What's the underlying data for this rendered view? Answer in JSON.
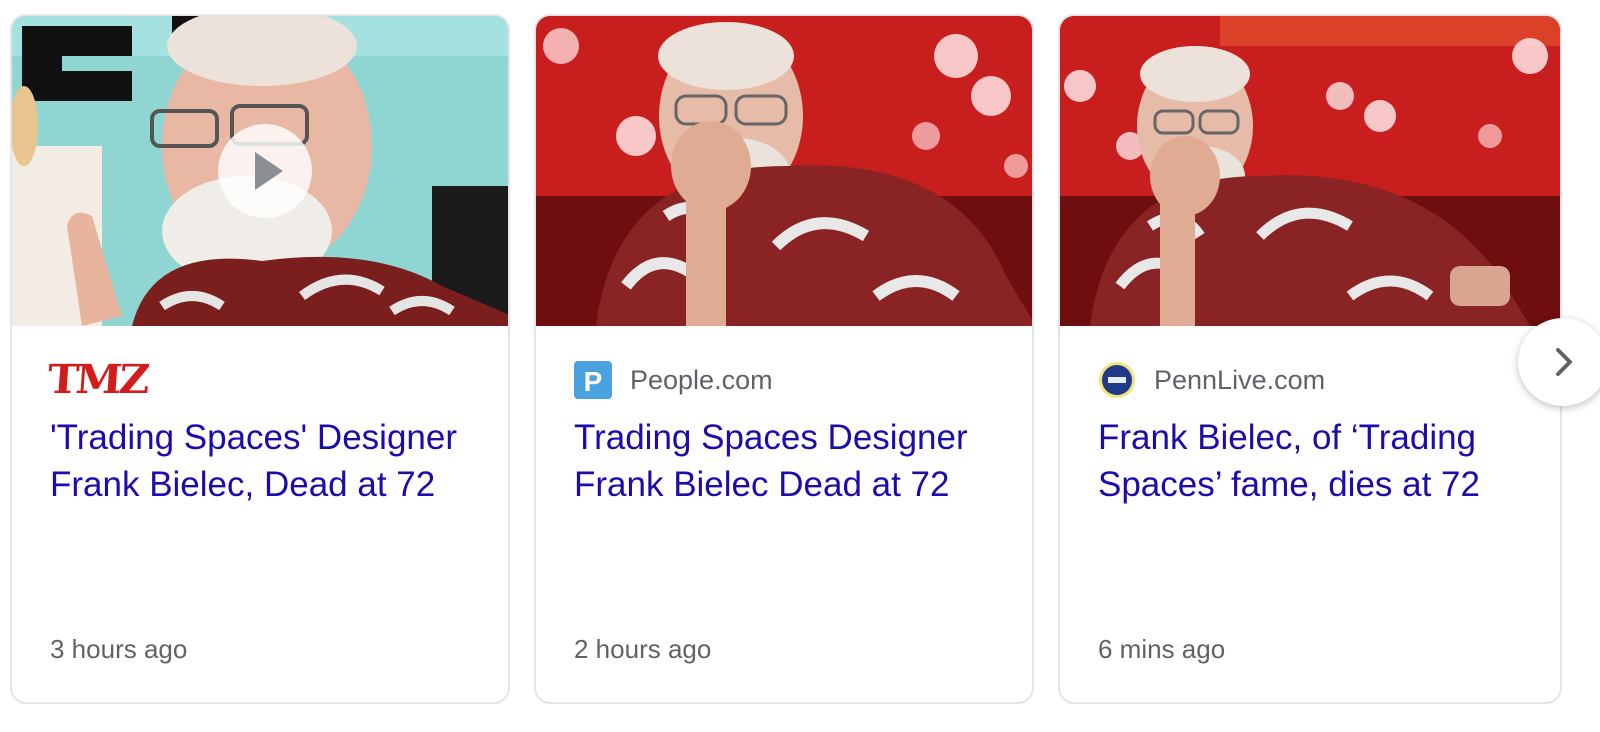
{
  "cards": [
    {
      "source": "TMZ",
      "headline": "'Trading Spaces' Designer Frank Bielec, Dead at 72",
      "time": "3 hours ago",
      "has_video": true
    },
    {
      "source": "People.com",
      "headline": "Trading Spaces Designer Frank Bielec Dead at 72",
      "time": "2 hours ago",
      "has_video": false
    },
    {
      "source": "PennLive.com",
      "headline": "Frank Bielec, of ‘Trading Spaces’ fame, dies at 72",
      "time": "6 mins ago",
      "has_video": false
    }
  ],
  "icons": {
    "play": "play-icon",
    "next": "chevron-right-icon"
  },
  "colors": {
    "headline": "#1a0dab",
    "meta": "#5f6368",
    "tmz_red": "#d31c1c",
    "people_blue": "#4aa3df",
    "pennlive_navy": "#1f3a8a"
  }
}
